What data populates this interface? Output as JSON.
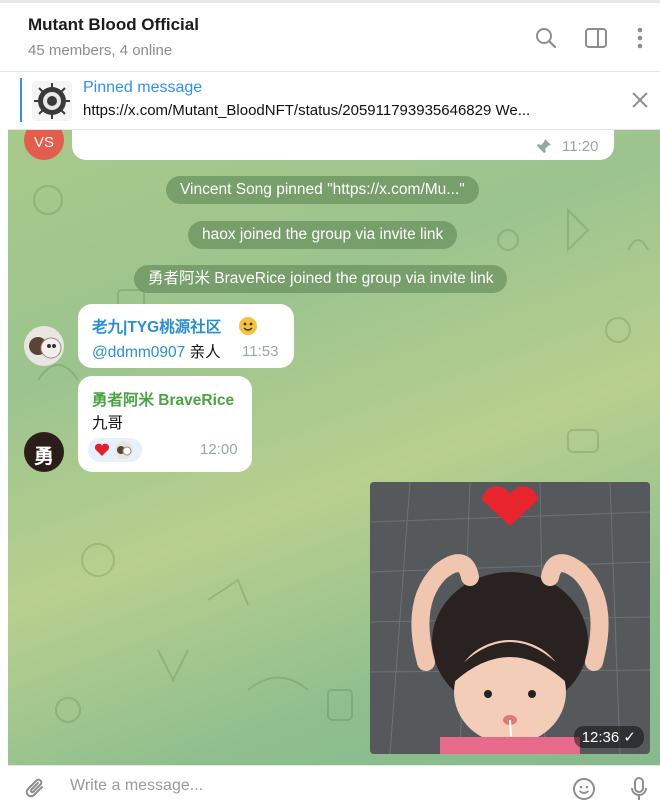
{
  "header": {
    "title": "Mutant Blood Official",
    "subtitle": "45 members, 4 online"
  },
  "pinned": {
    "title": "Pinned message",
    "text": "https://x.com/Mutant_BloodNFT/status/2059117939356468​29 We..."
  },
  "messages": {
    "first": {
      "avatar_text": "VS",
      "time": "11:20"
    },
    "service1": "Vincent Song pinned \"https://x.com/Mu...\"",
    "service2": "haox joined the group via invite link",
    "service3": "勇者阿米 BraveRice joined the group via invite link",
    "msg1": {
      "sender": "老九|TYG桃源社区",
      "mention": "@ddmm0907",
      "text": " 亲人",
      "time": "11:53"
    },
    "msg2": {
      "sender": "勇者阿米 BraveRice",
      "avatar_text": "勇",
      "text": "九哥",
      "time": "12:00"
    },
    "photo": {
      "time": "12:36"
    }
  },
  "composer": {
    "placeholder": "Write a message..."
  },
  "colors": {
    "accent": "#3390ec",
    "sender_blue": "#2b8fcf",
    "sender_green": "#4aa343"
  }
}
